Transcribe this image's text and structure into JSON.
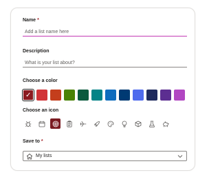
{
  "form": {
    "name_label": "Name",
    "required_mark": "*",
    "name_placeholder": "Add a list name here",
    "description_label": "Description",
    "description_placeholder": "What is your list about?",
    "color_label": "Choose a color",
    "icon_label": "Choose an icon",
    "save_label": "Save to",
    "save_value": "My lists"
  },
  "colors": [
    {
      "hex": "#8b1a1f",
      "selected": true
    },
    {
      "hex": "#d13438",
      "selected": false
    },
    {
      "hex": "#c43e1c",
      "selected": false
    },
    {
      "hex": "#498205",
      "selected": false
    },
    {
      "hex": "#0b5a3e",
      "selected": false
    },
    {
      "hex": "#038387",
      "selected": false
    },
    {
      "hex": "#0f6cbd",
      "selected": false
    },
    {
      "hex": "#003a73",
      "selected": false
    },
    {
      "hex": "#4f6bed",
      "selected": false
    },
    {
      "hex": "#1f2a5e",
      "selected": false
    },
    {
      "hex": "#5c2e91",
      "selected": false
    },
    {
      "hex": "#b146c2",
      "selected": false
    }
  ],
  "icons": [
    {
      "name": "bug-icon",
      "selected": false
    },
    {
      "name": "calendar-icon",
      "selected": false
    },
    {
      "name": "target-icon",
      "selected": true
    },
    {
      "name": "clipboard-icon",
      "selected": false
    },
    {
      "name": "airplane-icon",
      "selected": false
    },
    {
      "name": "rocket-icon",
      "selected": false
    },
    {
      "name": "palette-icon",
      "selected": false
    },
    {
      "name": "lightbulb-icon",
      "selected": false
    },
    {
      "name": "cube-icon",
      "selected": false
    },
    {
      "name": "beaker-icon",
      "selected": false
    },
    {
      "name": "piggy-bank-icon",
      "selected": false
    }
  ],
  "accent_color": "#c239b3"
}
